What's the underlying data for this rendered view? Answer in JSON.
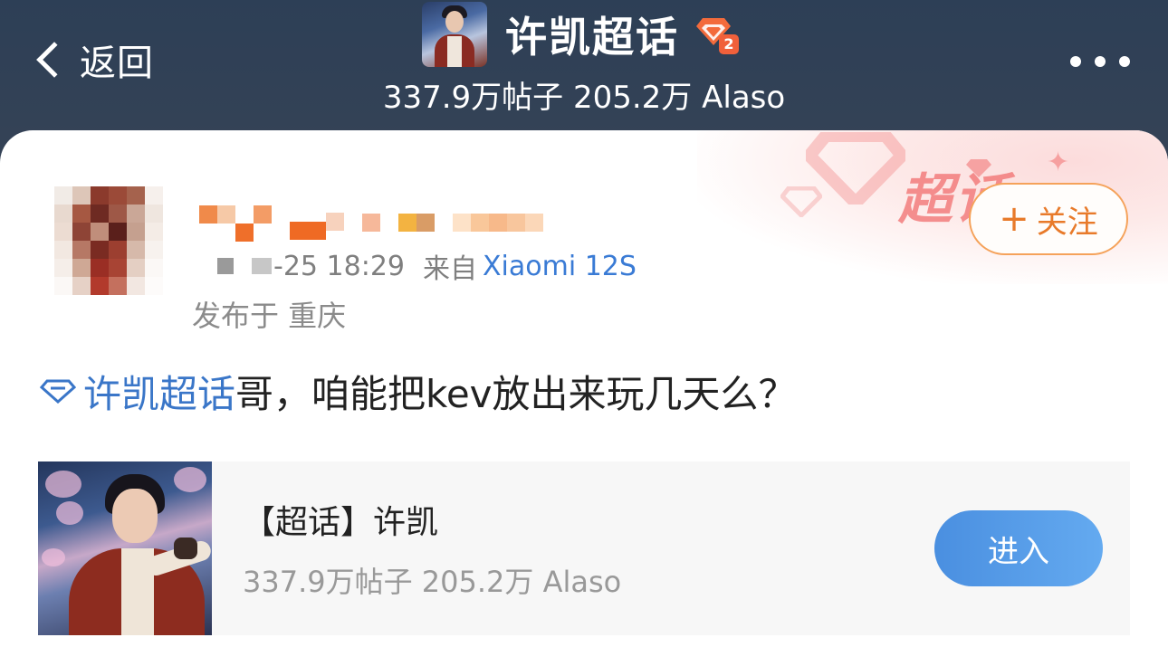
{
  "header": {
    "back_label": "返回",
    "title": "许凯超话",
    "level": "2",
    "stats": "337.9万帖子 205.2万 Alaso"
  },
  "post": {
    "time": "-25 18:29",
    "source_prefix": "来自",
    "source_device": "Xiaomi 12S",
    "location": "发布于 重庆",
    "follow_label": "关注",
    "topic_link": "许凯超话",
    "text": "哥，咱能把kev放出来玩几天么？"
  },
  "topic_card": {
    "title": "【超话】许凯",
    "stats": "337.9万帖子 205.2万 Alaso",
    "enter_label": "进入"
  },
  "decoration": {
    "super_topic_label": "超话"
  },
  "colors": {
    "link_blue": "#3a76c8",
    "follow_orange": "#e87a2a",
    "enter_blue": "#4a8fe0"
  }
}
